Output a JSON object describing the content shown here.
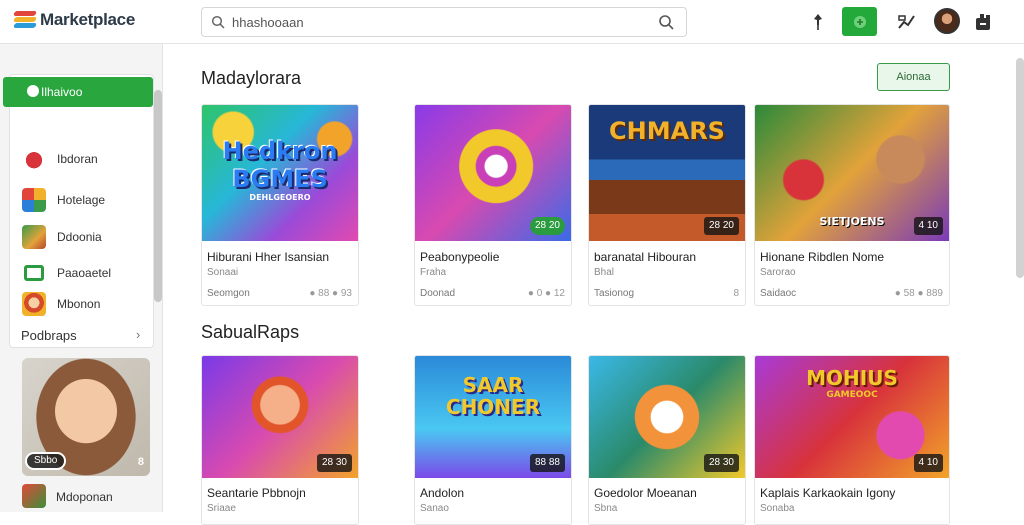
{
  "app": {
    "title": "Marketplace"
  },
  "search": {
    "value": "hhashooaan"
  },
  "sidebar": {
    "active": "Ilhaivoo",
    "items": [
      "Ibdoran",
      "Hotelage",
      "Ddoonia",
      "Paaoaetel",
      "Mbonon"
    ],
    "section_title": "Podbraps",
    "promo_label": "Sbbo",
    "promo_count": "8",
    "last_item": "Mdoponan"
  },
  "section1": {
    "title": "Madaylorara",
    "button": "Aionaa",
    "cards": [
      {
        "img_text": "Hedkron BGMES",
        "img_sub": "DEHLGEOERO",
        "badge": "",
        "title": "Hiburani Hher Isansian",
        "sub": "Sonaai",
        "meta": "Seomgon",
        "stats": "● 88 ● 93"
      },
      {
        "img_text": "",
        "img_sub": "",
        "badge": "28 20",
        "title": "Peabonypeolie",
        "sub": "Fraha",
        "meta": "Doonad",
        "stats": "● 0 ● 12"
      },
      {
        "img_text": "CHMARS",
        "img_sub": "",
        "badge": "28 20",
        "title": "baranatal Hibouran",
        "sub": "Bhal",
        "meta": "Tasionog",
        "stats": "8"
      },
      {
        "img_text": "",
        "img_sub": "SIETJOENS",
        "badge": "4 10",
        "title": "Hionane Ribdlen Nome",
        "sub": "Sarorao",
        "meta": "Saidaoc",
        "stats": "● 58 ● 889"
      }
    ]
  },
  "section2": {
    "title": "SabualRaps",
    "cards": [
      {
        "img_text": "",
        "img_sub": "",
        "badge": "28 30",
        "title": "Seantarie Pbbnojn",
        "sub": "Sriaae",
        "meta": "",
        "stats": ""
      },
      {
        "img_text": "SAAR CHONER",
        "img_sub": "",
        "badge": "88 88",
        "title": "Andolon",
        "sub": "Sanao",
        "meta": "",
        "stats": ""
      },
      {
        "img_text": "",
        "img_sub": "",
        "badge": "28 30",
        "title": "Goedolor Moeanan",
        "sub": "Sbna",
        "meta": "",
        "stats": ""
      },
      {
        "img_text": "MOHIUS",
        "img_sub": "GAMEOOC",
        "badge": "4 10",
        "title": "Kaplais Karkaokain Igony",
        "sub": "Sonaba",
        "meta": "",
        "stats": ""
      }
    ]
  },
  "colors": {
    "accent": "#2aa63e",
    "text": "#222222"
  }
}
